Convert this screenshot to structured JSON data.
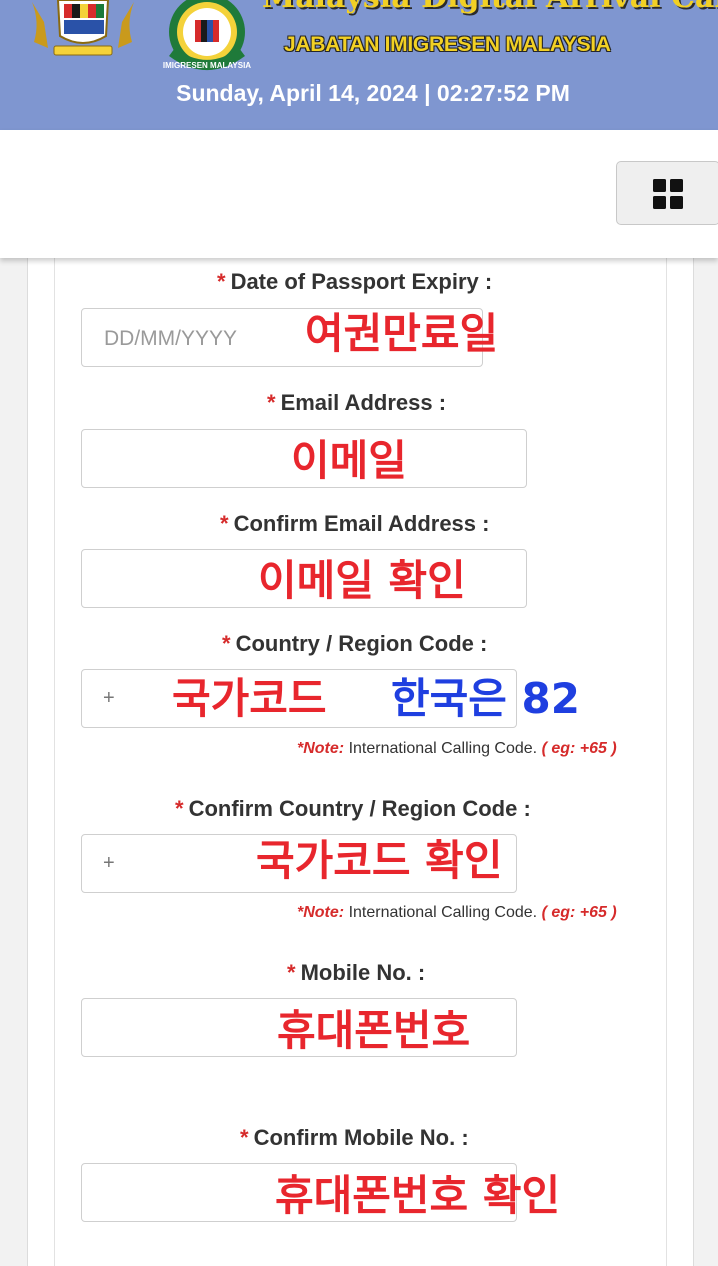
{
  "header": {
    "title": "Malaysia Digital Arrival Card",
    "department": "JABATAN IMIGRESEN MALAYSIA",
    "logo_caption": "IMIGRESEN MALAYSIA",
    "datetime": "Sunday, April 14, 2024 | 02:27:52 PM",
    "colors": {
      "background": "#7f96d0",
      "title": "#f2d024",
      "datetime": "#ffffff"
    }
  },
  "navbar": {
    "menu_icon": "grid-menu-icon"
  },
  "form": {
    "passport_expiry": {
      "label": "Date of Passport Expiry :",
      "placeholder": "DD/MM/YYYY"
    },
    "email": {
      "label": "Email Address :"
    },
    "confirm_email": {
      "label": "Confirm Email Address :"
    },
    "country_code": {
      "label": "Country / Region Code :",
      "prefix": "+",
      "note_prefix": "*Note:",
      "note_text": "International Calling Code.",
      "note_example": "( eg: +65 )"
    },
    "confirm_country_code": {
      "label": "Confirm Country / Region Code :",
      "prefix": "+",
      "note_prefix": "*Note:",
      "note_text": "International Calling Code.",
      "note_example": "( eg: +65 )"
    },
    "mobile": {
      "label": "Mobile No. :"
    },
    "confirm_mobile": {
      "label": "Confirm Mobile No. :"
    },
    "required_marker": "*"
  },
  "annotations": {
    "passport_expiry": "여권만료일",
    "email": "이메일",
    "confirm_email": "이메일 확인",
    "country_code": "국가코드",
    "korea_code": "한국은 82",
    "confirm_country_code": "국가코드 확인",
    "mobile": "휴대폰번호",
    "confirm_mobile": "휴대폰번호 확인",
    "colors": {
      "red": "#e8262d",
      "blue": "#1f3fe0"
    }
  }
}
